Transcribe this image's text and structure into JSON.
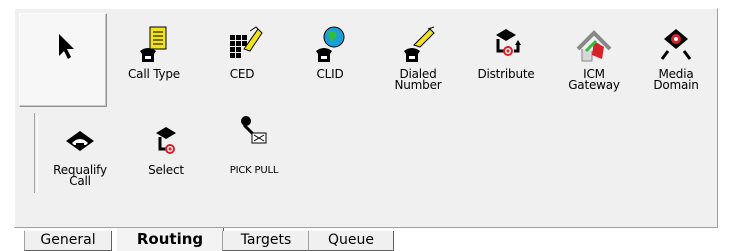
{
  "palette": {
    "tools": [
      {
        "label": "",
        "icon": "pointer-arrow-icon"
      },
      {
        "label": "Call Type",
        "icon": "call-type-icon"
      },
      {
        "label": "CED",
        "icon": "ced-icon"
      },
      {
        "label": "CLID",
        "icon": "clid-icon"
      },
      {
        "label": "Dialed\nNumber",
        "icon": "dialed-number-icon"
      },
      {
        "label": "Distribute",
        "icon": "distribute-icon"
      },
      {
        "label": "ICM\nGateway",
        "icon": "icm-gateway-icon"
      },
      {
        "label": "Media\nDomain",
        "icon": "media-domain-icon"
      },
      {
        "label": "Requalify\nCall",
        "icon": "requalify-call-icon"
      },
      {
        "label": "Select",
        "icon": "select-icon"
      },
      {
        "label": "PICK PULL",
        "icon": "pick-pull-icon"
      }
    ]
  },
  "tabs": [
    {
      "label": "General",
      "active": false
    },
    {
      "label": "Routing",
      "active": true
    },
    {
      "label": "Targets",
      "active": false
    },
    {
      "label": "Queue",
      "active": false
    }
  ],
  "colors": {
    "panel": "#f0f0f0",
    "phone": "#1a1a1a",
    "folder": "#f2e21c",
    "globe": "#1aa0d8",
    "red": "#d6202a"
  }
}
